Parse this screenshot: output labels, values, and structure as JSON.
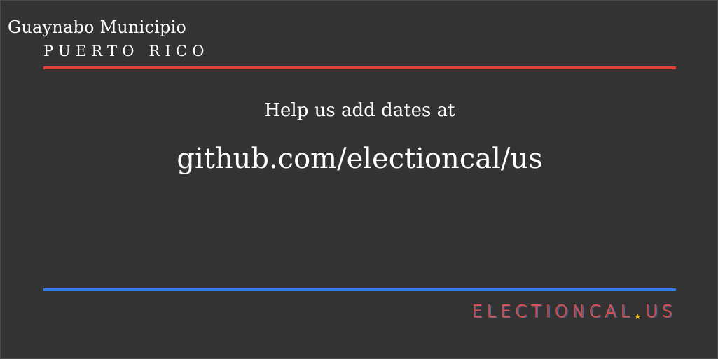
{
  "header": {
    "municipio": "Guaynabo Municipio",
    "state": "PUERTO RICO"
  },
  "main": {
    "help_text": "Help us add dates at",
    "repo_link": "github.com/electioncal/us"
  },
  "footer": {
    "brand_name": "ELECTIONCAL",
    "brand_tld": "US",
    "star_icon": "star-icon"
  },
  "colors": {
    "background": "#333333",
    "top_rule": "#e0403a",
    "bottom_rule": "#2e7ee6",
    "brand_red": "#d9534f",
    "brand_blue": "#4a7cd6",
    "star": "#f2c21b"
  }
}
